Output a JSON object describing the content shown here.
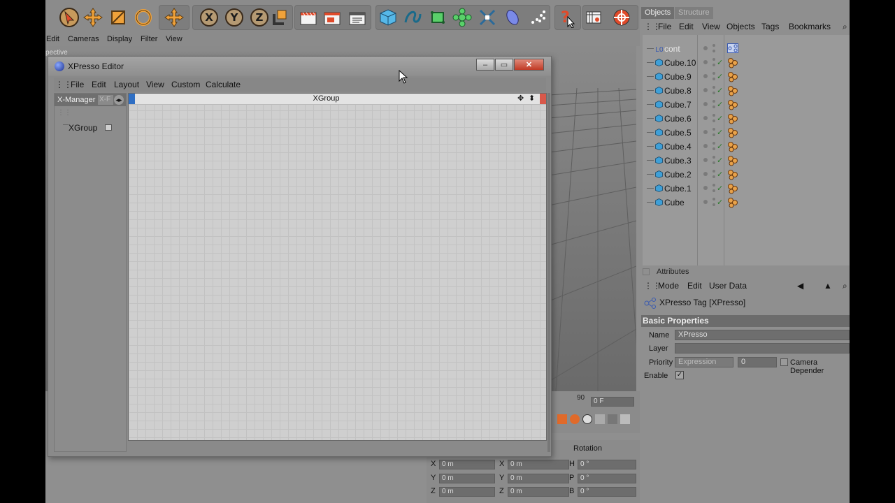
{
  "toolbar": {
    "icons": [
      "pointer-icon",
      "move-icon",
      "scale-icon",
      "rotate-icon",
      "move-axis-icon",
      "x-axis-icon",
      "y-axis-icon",
      "z-axis-icon",
      "world-coordinate-icon",
      "render-view-icon",
      "render-picture-viewer-icon",
      "render-settings-icon",
      "cube-icon",
      "spline-icon",
      "nurbs-icon",
      "mograph-icon",
      "deformer-icon",
      "scene-icon",
      "particles-icon",
      "help-icon",
      "timeline-icon",
      "python-icon"
    ],
    "x_label": "X",
    "y_label": "Y",
    "z_label": "Z"
  },
  "viewport": {
    "menu": [
      "Edit",
      "Cameras",
      "Display",
      "Filter",
      "View"
    ],
    "label": "pective"
  },
  "timeline": {
    "frame_tick": "90",
    "frame_field": "0 F"
  },
  "coordinates": {
    "rotation_header": "Rotation",
    "rows": [
      {
        "axis": "X",
        "pos": "0 m",
        "axis2": "X",
        "size": "0 m",
        "rot_axis": "H",
        "rot": "0 °"
      },
      {
        "axis": "Y",
        "pos": "0 m",
        "axis2": "Y",
        "size": "0 m",
        "rot_axis": "P",
        "rot": "0 °"
      },
      {
        "axis": "Z",
        "pos": "0 m",
        "axis2": "Z",
        "size": "0 m",
        "rot_axis": "B",
        "rot": "0 °"
      }
    ]
  },
  "objects_panel": {
    "tabs": [
      "Objects",
      "Structure"
    ],
    "menu": [
      "File",
      "Edit",
      "View",
      "Objects",
      "Tags",
      "Bookmarks"
    ],
    "items": [
      {
        "name": "cont",
        "type": "null"
      },
      {
        "name": "Cube.10",
        "type": "cube"
      },
      {
        "name": "Cube.9",
        "type": "cube"
      },
      {
        "name": "Cube.8",
        "type": "cube"
      },
      {
        "name": "Cube.7",
        "type": "cube"
      },
      {
        "name": "Cube.6",
        "type": "cube"
      },
      {
        "name": "Cube.5",
        "type": "cube"
      },
      {
        "name": "Cube.4",
        "type": "cube"
      },
      {
        "name": "Cube.3",
        "type": "cube"
      },
      {
        "name": "Cube.2",
        "type": "cube"
      },
      {
        "name": "Cube.1",
        "type": "cube"
      },
      {
        "name": "Cube",
        "type": "cube"
      }
    ]
  },
  "attributes": {
    "title": "Attributes",
    "menu": [
      "Mode",
      "Edit",
      "User Data"
    ],
    "object_label": "XPresso Tag [XPresso]",
    "section": "Basic Properties",
    "name_label": "Name",
    "name_value": "XPresso",
    "layer_label": "Layer",
    "priority_label": "Priority",
    "priority_value": "Expression",
    "priority_num": "0",
    "camera_dep_label": "Camera Depender",
    "enable_label": "Enable"
  },
  "xpresso": {
    "title": "XPresso Editor",
    "menu": [
      "File",
      "Edit",
      "Layout",
      "View",
      "Custom",
      "Calculate"
    ],
    "manager_label": "X-Manager",
    "manager_tab2": "X-F",
    "tree_item": "XGroup",
    "canvas_title": "XGroup"
  },
  "colors": {
    "accent_blue": "#2f6fc4",
    "close_red": "#c03a25",
    "cube_icon": "#3fa0d8"
  }
}
